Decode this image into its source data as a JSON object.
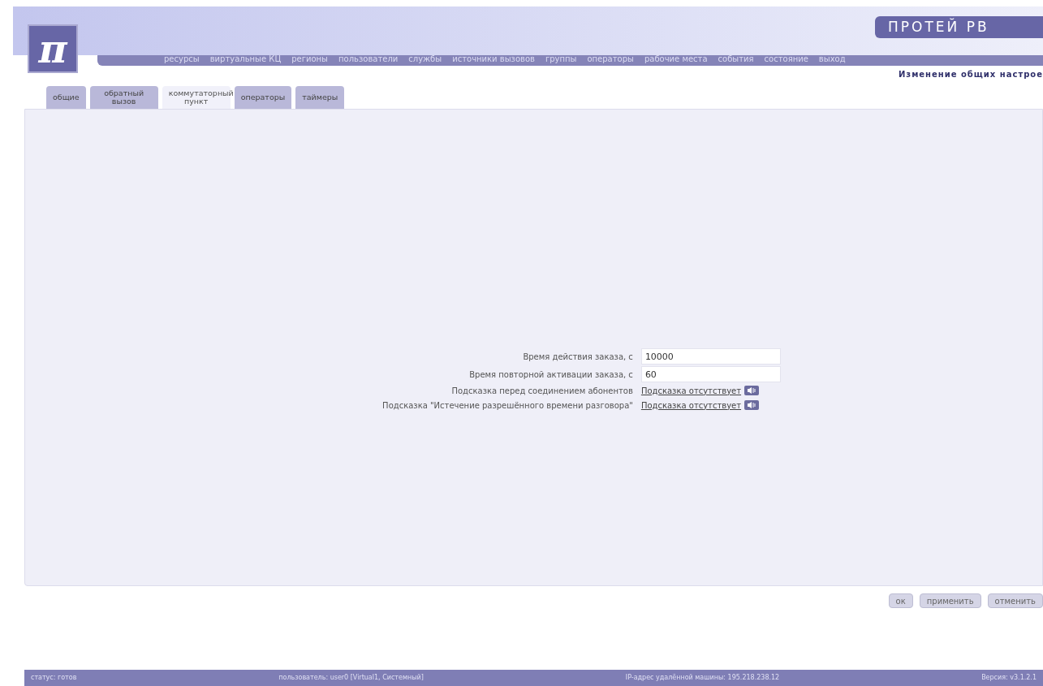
{
  "header": {
    "title": "ПРОТЕЙ РВ",
    "logo": "π",
    "subtitle": "Изменение общих настрое"
  },
  "nav": [
    "ресурсы",
    "виртуальные КЦ",
    "регионы",
    "пользователи",
    "службы",
    "источники вызовов",
    "группы",
    "операторы",
    "рабочие места",
    "события",
    "состояние",
    "выход"
  ],
  "tabs": [
    {
      "label": "общие",
      "selected": false
    },
    {
      "label": "обратный вызов",
      "selected": false
    },
    {
      "label": "коммутаторный пункт",
      "selected": true
    },
    {
      "label": "операторы",
      "selected": false
    },
    {
      "label": "таймеры",
      "selected": false
    }
  ],
  "form": [
    {
      "kind": "input",
      "label": "Время действия заказа, с",
      "value": "10000"
    },
    {
      "kind": "input",
      "label": "Время повторной активации заказа, с",
      "value": "60"
    },
    {
      "kind": "sound",
      "label": "Подсказка перед соединением абонентов",
      "value": "Подсказка отсутствует"
    },
    {
      "kind": "sound",
      "label": "Подсказка \"Истечение разрешённого времени разговора\"",
      "value": "Подсказка отсутствует"
    }
  ],
  "buttons": [
    "ок",
    "применить",
    "отменить"
  ],
  "status_bar": [
    "статус: готов",
    "пользователь: user0 [Virtual1, Системный]",
    "IP-адрес удалённой машины: 195.218.238.12",
    "Версия: v3.1.2.1"
  ]
}
